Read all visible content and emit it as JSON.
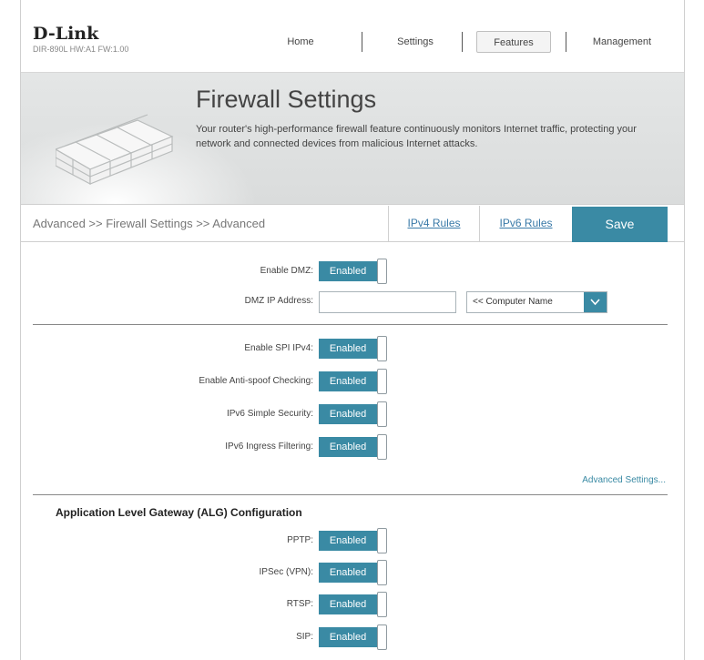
{
  "header": {
    "logo": "D-Link",
    "device_info": "DIR-890L   HW:A1   FW:1.00",
    "nav": [
      "Home",
      "Settings",
      "Features",
      "Management"
    ],
    "active_nav": "Features"
  },
  "hero": {
    "title": "Firewall Settings",
    "description": "Your router's high-performance firewall feature continuously monitors Internet traffic, protecting your network and connected devices from malicious Internet attacks."
  },
  "tabbar": {
    "breadcrumb": "Advanced >> Firewall Settings >> Advanced",
    "tab_ipv4": "IPv4 Rules",
    "tab_ipv6": "IPv6 Rules",
    "save": "Save"
  },
  "dmz": {
    "enable_label": "Enable DMZ:",
    "enable_value": "Enabled",
    "ip_label": "DMZ IP Address:",
    "ip_value": "",
    "computer_select": "<< Computer Name"
  },
  "security": {
    "spi_label": "Enable SPI IPv4:",
    "spi_value": "Enabled",
    "antispoof_label": "Enable Anti-spoof Checking:",
    "antispoof_value": "Enabled",
    "ipv6_simple_label": "IPv6 Simple Security:",
    "ipv6_simple_value": "Enabled",
    "ipv6_ingress_label": "IPv6 Ingress Filtering:",
    "ipv6_ingress_value": "Enabled",
    "advanced_link": "Advanced Settings..."
  },
  "alg": {
    "title": "Application Level Gateway (ALG) Configuration",
    "pptp_label": "PPTP:",
    "pptp_value": "Enabled",
    "ipsec_label": "IPSec (VPN):",
    "ipsec_value": "Enabled",
    "rtsp_label": "RTSP:",
    "rtsp_value": "Enabled",
    "sip_label": "SIP:",
    "sip_value": "Enabled"
  },
  "colors": {
    "accent": "#3a8aa4",
    "link": "#3a7aa8"
  }
}
